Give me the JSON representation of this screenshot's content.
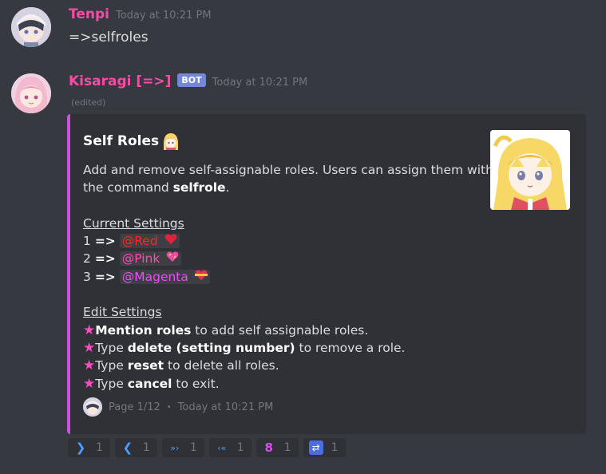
{
  "messages": [
    {
      "username": "Tenpi",
      "timestamp": "Today at 10:21 PM",
      "content": "=>selfroles"
    },
    {
      "username": "Kisaragi [=>]",
      "bot_tag": "BOT",
      "timestamp": "Today at 10:21 PM",
      "edited": "(edited)"
    }
  ],
  "embed": {
    "color": "#d04ee5",
    "title": "Self Roles",
    "description": {
      "intro_1": "Add and remove self-assignable roles. Users can assign them with",
      "intro_2_prefix": "the command ",
      "intro_2_bold": "selfrole",
      "intro_2_suffix": ".",
      "current_heading": "Current Settings",
      "roles": [
        {
          "number": "1",
          "arrow": "=>",
          "mention": "@Red",
          "color": "#ff2424"
        },
        {
          "number": "2",
          "arrow": "=>",
          "mention": "@Pink",
          "color": "#ff49b2"
        },
        {
          "number": "3",
          "arrow": "=>",
          "mention": "@Magenta",
          "color": "#e84ef2"
        }
      ],
      "edit_heading": "Edit Settings",
      "edit_lines": [
        {
          "pre": "",
          "bold": "Mention roles",
          "post": " to add self assignable roles."
        },
        {
          "pre": "Type ",
          "bold": "delete (setting number)",
          "post": " to remove a role."
        },
        {
          "pre": "Type ",
          "bold": "reset",
          "post": " to delete all roles."
        },
        {
          "pre": "Type ",
          "bold": "cancel",
          "post": " to exit."
        }
      ]
    },
    "footer": {
      "page": "Page 1/12",
      "separator": "•",
      "timestamp": "Today at 10:21 PM"
    }
  },
  "reactions": [
    {
      "icon": "right-arrow-icon",
      "glyph": "❯",
      "count": "1",
      "color": "#4f9dff"
    },
    {
      "icon": "left-arrow-icon",
      "glyph": "❮",
      "count": "1",
      "color": "#4f9dff"
    },
    {
      "icon": "fast-forward-icon",
      "glyph": "»›",
      "count": "1",
      "color": "#4f9dff"
    },
    {
      "icon": "rewind-icon",
      "glyph": "‹«",
      "count": "1",
      "color": "#4f9dff"
    },
    {
      "icon": "numbers-icon",
      "glyph": "8",
      "count": "1",
      "color": "#d94ef0"
    },
    {
      "icon": "repeat-icon",
      "glyph": "⇄",
      "count": "1",
      "color": "#5b82ff"
    }
  ]
}
